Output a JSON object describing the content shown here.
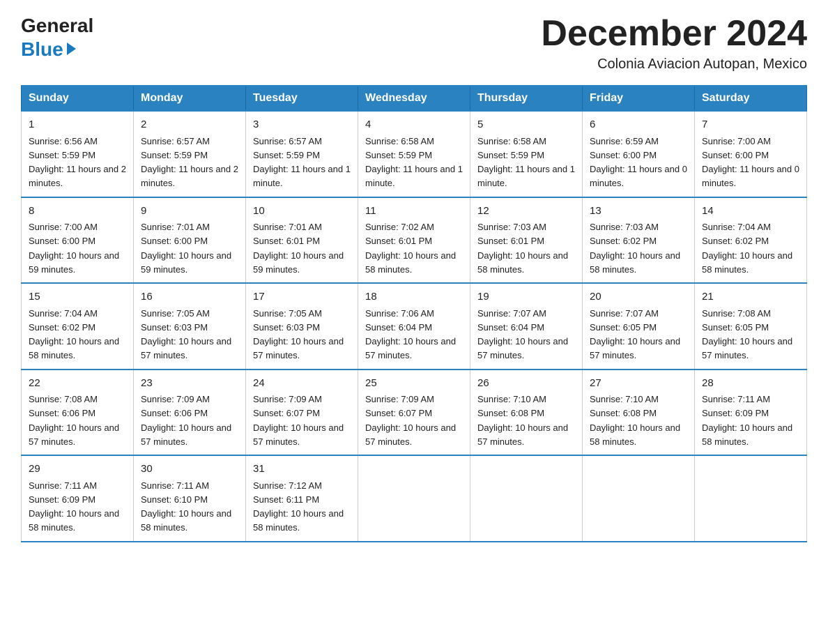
{
  "header": {
    "logo_general": "General",
    "logo_blue": "Blue",
    "month_title": "December 2024",
    "location": "Colonia Aviacion Autopan, Mexico"
  },
  "weekdays": [
    "Sunday",
    "Monday",
    "Tuesday",
    "Wednesday",
    "Thursday",
    "Friday",
    "Saturday"
  ],
  "weeks": [
    [
      {
        "day": "1",
        "sunrise": "6:56 AM",
        "sunset": "5:59 PM",
        "daylight": "11 hours and 2 minutes."
      },
      {
        "day": "2",
        "sunrise": "6:57 AM",
        "sunset": "5:59 PM",
        "daylight": "11 hours and 2 minutes."
      },
      {
        "day": "3",
        "sunrise": "6:57 AM",
        "sunset": "5:59 PM",
        "daylight": "11 hours and 1 minute."
      },
      {
        "day": "4",
        "sunrise": "6:58 AM",
        "sunset": "5:59 PM",
        "daylight": "11 hours and 1 minute."
      },
      {
        "day": "5",
        "sunrise": "6:58 AM",
        "sunset": "5:59 PM",
        "daylight": "11 hours and 1 minute."
      },
      {
        "day": "6",
        "sunrise": "6:59 AM",
        "sunset": "6:00 PM",
        "daylight": "11 hours and 0 minutes."
      },
      {
        "day": "7",
        "sunrise": "7:00 AM",
        "sunset": "6:00 PM",
        "daylight": "11 hours and 0 minutes."
      }
    ],
    [
      {
        "day": "8",
        "sunrise": "7:00 AM",
        "sunset": "6:00 PM",
        "daylight": "10 hours and 59 minutes."
      },
      {
        "day": "9",
        "sunrise": "7:01 AM",
        "sunset": "6:00 PM",
        "daylight": "10 hours and 59 minutes."
      },
      {
        "day": "10",
        "sunrise": "7:01 AM",
        "sunset": "6:01 PM",
        "daylight": "10 hours and 59 minutes."
      },
      {
        "day": "11",
        "sunrise": "7:02 AM",
        "sunset": "6:01 PM",
        "daylight": "10 hours and 58 minutes."
      },
      {
        "day": "12",
        "sunrise": "7:03 AM",
        "sunset": "6:01 PM",
        "daylight": "10 hours and 58 minutes."
      },
      {
        "day": "13",
        "sunrise": "7:03 AM",
        "sunset": "6:02 PM",
        "daylight": "10 hours and 58 minutes."
      },
      {
        "day": "14",
        "sunrise": "7:04 AM",
        "sunset": "6:02 PM",
        "daylight": "10 hours and 58 minutes."
      }
    ],
    [
      {
        "day": "15",
        "sunrise": "7:04 AM",
        "sunset": "6:02 PM",
        "daylight": "10 hours and 58 minutes."
      },
      {
        "day": "16",
        "sunrise": "7:05 AM",
        "sunset": "6:03 PM",
        "daylight": "10 hours and 57 minutes."
      },
      {
        "day": "17",
        "sunrise": "7:05 AM",
        "sunset": "6:03 PM",
        "daylight": "10 hours and 57 minutes."
      },
      {
        "day": "18",
        "sunrise": "7:06 AM",
        "sunset": "6:04 PM",
        "daylight": "10 hours and 57 minutes."
      },
      {
        "day": "19",
        "sunrise": "7:07 AM",
        "sunset": "6:04 PM",
        "daylight": "10 hours and 57 minutes."
      },
      {
        "day": "20",
        "sunrise": "7:07 AM",
        "sunset": "6:05 PM",
        "daylight": "10 hours and 57 minutes."
      },
      {
        "day": "21",
        "sunrise": "7:08 AM",
        "sunset": "6:05 PM",
        "daylight": "10 hours and 57 minutes."
      }
    ],
    [
      {
        "day": "22",
        "sunrise": "7:08 AM",
        "sunset": "6:06 PM",
        "daylight": "10 hours and 57 minutes."
      },
      {
        "day": "23",
        "sunrise": "7:09 AM",
        "sunset": "6:06 PM",
        "daylight": "10 hours and 57 minutes."
      },
      {
        "day": "24",
        "sunrise": "7:09 AM",
        "sunset": "6:07 PM",
        "daylight": "10 hours and 57 minutes."
      },
      {
        "day": "25",
        "sunrise": "7:09 AM",
        "sunset": "6:07 PM",
        "daylight": "10 hours and 57 minutes."
      },
      {
        "day": "26",
        "sunrise": "7:10 AM",
        "sunset": "6:08 PM",
        "daylight": "10 hours and 57 minutes."
      },
      {
        "day": "27",
        "sunrise": "7:10 AM",
        "sunset": "6:08 PM",
        "daylight": "10 hours and 58 minutes."
      },
      {
        "day": "28",
        "sunrise": "7:11 AM",
        "sunset": "6:09 PM",
        "daylight": "10 hours and 58 minutes."
      }
    ],
    [
      {
        "day": "29",
        "sunrise": "7:11 AM",
        "sunset": "6:09 PM",
        "daylight": "10 hours and 58 minutes."
      },
      {
        "day": "30",
        "sunrise": "7:11 AM",
        "sunset": "6:10 PM",
        "daylight": "10 hours and 58 minutes."
      },
      {
        "day": "31",
        "sunrise": "7:12 AM",
        "sunset": "6:11 PM",
        "daylight": "10 hours and 58 minutes."
      },
      null,
      null,
      null,
      null
    ]
  ]
}
